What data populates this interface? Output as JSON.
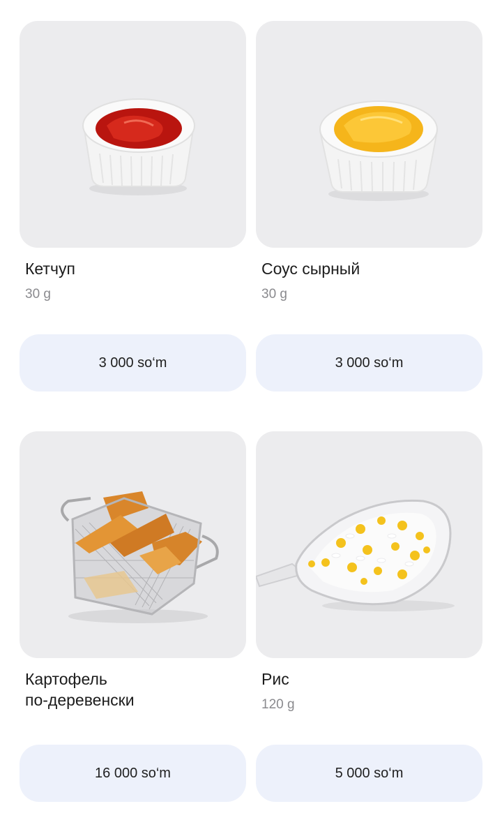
{
  "products": [
    {
      "name": "Кетчуп",
      "weight": "30 g",
      "price": "3 000 so‘m",
      "image_icon": "ketchup-bowl"
    },
    {
      "name": "Соус сырный",
      "weight": "30 g",
      "price": "3 000 so‘m",
      "image_icon": "cheese-sauce-bowl"
    },
    {
      "name": "Картофель\nпо-деревенски",
      "weight": "",
      "price": "16 000 so‘m",
      "image_icon": "potato-wedges-basket"
    },
    {
      "name": "Рис",
      "weight": "120 g",
      "price": "5 000 so‘m",
      "image_icon": "rice-bowl"
    }
  ],
  "colors": {
    "photo_background": "#ececee",
    "price_button_background": "#edf1fb",
    "name_text": "#1c1c1c",
    "weight_text": "#8a8a8e"
  }
}
